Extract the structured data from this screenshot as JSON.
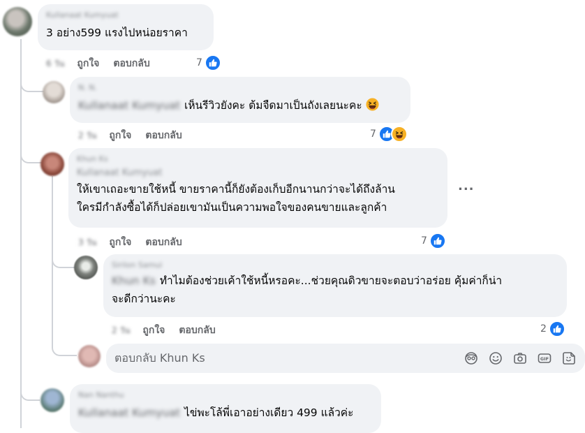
{
  "comments": [
    {
      "name": "Kullanaat Kumyuat",
      "text": "3 อย่าง599 แรงไปหน่อยราคา",
      "time": "6 วัน",
      "like_label": "ถูกใจ",
      "reply_label": "ตอบกลับ",
      "reaction_count": "7"
    },
    {
      "name": "N. N.",
      "mention": "Kullanaat Kumyuat",
      "text": "เห็นรีวิวยังคะ ต้มจืดมาเป็นถังเลยนะคะ",
      "time": "2 วัน",
      "like_label": "ถูกใจ",
      "reply_label": "ตอบกลับ",
      "reaction_count": "7"
    },
    {
      "name": "Khun Ks",
      "mention": "Kullanaat Kumyuat",
      "line1": "ให้เขาเถอะขายใช้หนี้ ขายราคานี้ก็ยังต้องเก็บอีกนานกว่าจะได้ถึงล้าน",
      "line2": "ใครมีกำลังซื้อได้ก็ปล่อยเขามันเป็นความพอใจของคนขายและลูกค้า",
      "more": "...",
      "time": "3 วัน",
      "like_label": "ถูกใจ",
      "reply_label": "ตอบกลับ",
      "reaction_count": "7"
    },
    {
      "name": "Sirilon Samui",
      "mention": "Khun Ks",
      "line1": "ทำไมต้องช่วยเค้าใช้หนี้หรอคะ...ช่วยคุณดิวขายจะตอบว่าอร่อย คุ้มค่าก็น่า",
      "line2": "จะดีกว่านะคะ",
      "time": "2 วัน",
      "like_label": "ถูกใจ",
      "reply_label": "ตอบกลับ",
      "reaction_count": "2"
    },
    {
      "name": "Nan Nanthu",
      "mention": "Kullanaat Kumyuat",
      "text": "ไข่พะโล้พี่เอาอย่างเดียว 499 แล้วค่ะ"
    }
  ],
  "reply_box": {
    "placeholder": "ตอบกลับ Khun Ks"
  },
  "colors": {
    "bubble": "#f0f2f5",
    "like_blue": "#1877f2",
    "muted": "#65676b",
    "thread": "#d0d3d8"
  }
}
